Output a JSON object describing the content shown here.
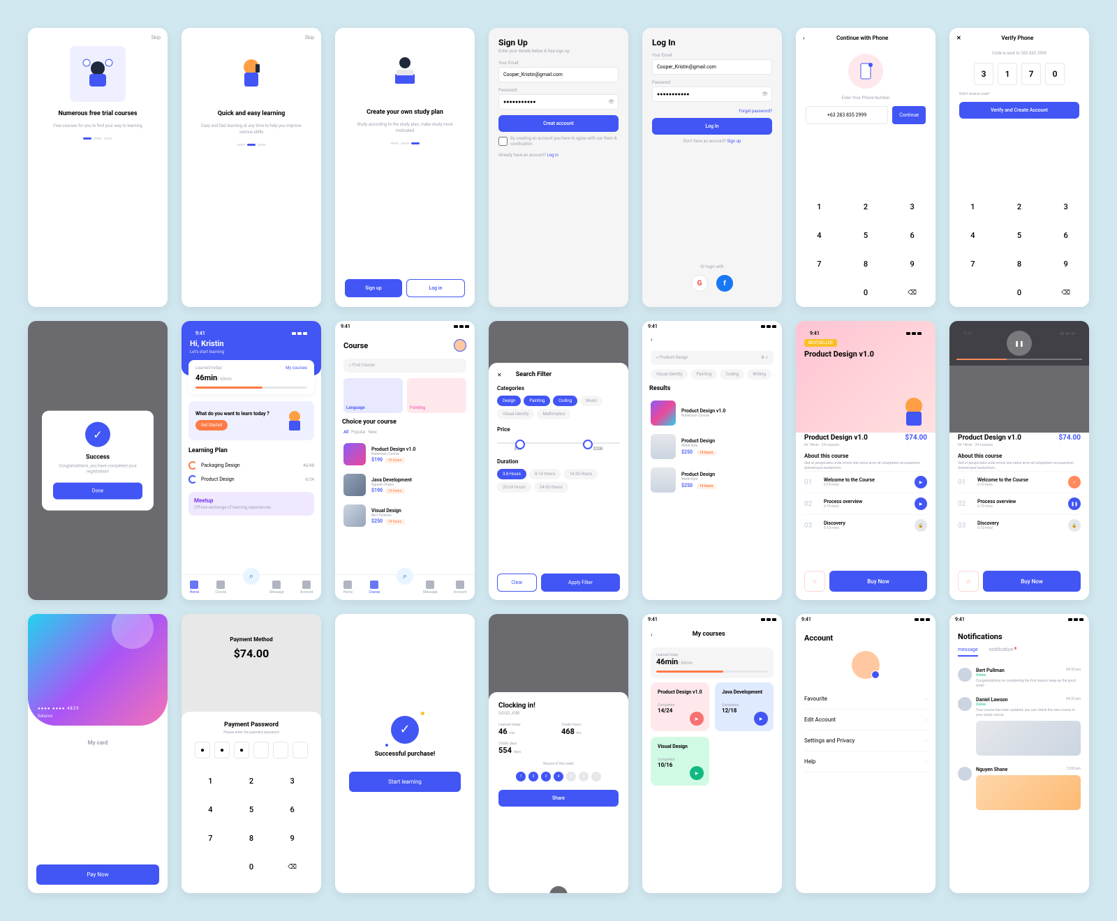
{
  "status_time": "9:41",
  "onb1": {
    "skip": "Skip",
    "title": "Numerous free trial courses",
    "desc": "Free courses for you to find your way to learning"
  },
  "onb2": {
    "skip": "Skip",
    "title": "Quick and easy learning",
    "desc": "Easy and fast learning at any time to help you improve various skills"
  },
  "onb3": {
    "title": "Create your own study plan",
    "desc": "Study according to the study plan, make study more motivated",
    "signup": "Sign up",
    "login": "Log in"
  },
  "signup": {
    "title": "Sign Up",
    "sub": "Enter your details below & free sign up",
    "email_label": "Your Email",
    "email": "Cooper_Kristin@gmail.com",
    "pw_label": "Password",
    "pw": "●●●●●●●●●●●",
    "btn": "Creat account",
    "check": "By creating an account you have to agree with our them & condication.",
    "already": "Already have an account?",
    "login": "Log in"
  },
  "login": {
    "title": "Log In",
    "email_label": "Your Email",
    "email": "Cooper_Kristin@gmail.com",
    "pw_label": "Password",
    "pw": "●●●●●●●●●●●",
    "forgot": "Forget password?",
    "btn": "Log In",
    "noacct": "Don't have an account?",
    "signup": "Sign up",
    "or": "Or login with"
  },
  "phone": {
    "title": "Continue with Phone",
    "enter": "Enter Your Phone Number",
    "value": "+63 283 835 2999",
    "continue": "Continue",
    "keys": [
      "1",
      "2",
      "3",
      "4",
      "5",
      "6",
      "7",
      "8",
      "9",
      "",
      "0",
      "⌫"
    ]
  },
  "verify": {
    "title": "Verify Phone",
    "sent": "Code is sent to 283 835 2999",
    "digits": [
      "3",
      "1",
      "7",
      "0"
    ],
    "didnt": "Didn't receive code?",
    "btn": "Verify and Create Account",
    "keys": [
      "1",
      "2",
      "3",
      "4",
      "5",
      "6",
      "7",
      "8",
      "9",
      "",
      "0",
      "⌫"
    ]
  },
  "success": {
    "title": "Success",
    "desc": "Congratulations, you have completed your registration!",
    "btn": "Done"
  },
  "home": {
    "greeting": "Hi, Kristin",
    "sub": "Let's start learning",
    "learned_label": "Learned today",
    "mycourses": "My courses",
    "learned_val": "46min",
    "learned_goal": "/ 60min",
    "promo_title": "What do you want to learn today ?",
    "promo_btn": "Get Started",
    "plan_title": "Learning Plan",
    "plan1": "Packaging Design",
    "plan1_prog": "40/48",
    "plan2": "Product Design",
    "plan2_prog": "6/24",
    "meetup_title": "Meetup",
    "meetup_desc": "Off-line exchange of learning experiences",
    "tabs": [
      "Home",
      "Course",
      "Search",
      "Message",
      "Account"
    ]
  },
  "course": {
    "title": "Course",
    "search": "Find Course",
    "cat1": "Language",
    "cat2": "Painting",
    "choice": "Choice your course",
    "chips": [
      "All",
      "Popular",
      "New"
    ],
    "c1_name": "Product Design v1.0",
    "c1_author": "Robertson Connie",
    "c1_price": "$190",
    "c1_badge": "16 hours",
    "c2_name": "Java Development",
    "c2_author": "Nguyen Shane",
    "c2_price": "$190",
    "c2_badge": "16 hours",
    "c3_name": "Visual Design",
    "c3_author": "Bert Pullman",
    "c3_price": "$250",
    "c3_badge": "14 hours"
  },
  "filter": {
    "title": "Search Filter",
    "categories": "Categories",
    "cats": [
      "Design",
      "Painting",
      "Coding",
      "Music",
      "Visual identity",
      "Mathmatics"
    ],
    "price": "Price",
    "price_min": "$90",
    "price_max": "$200",
    "duration": "Duration",
    "durs": [
      "3-8 Hours",
      "8-14 Hours",
      "14-20 Hours",
      "20-24 Hours",
      "24-30 Hours"
    ],
    "clear": "Clear",
    "apply": "Apply Filter"
  },
  "results": {
    "search": "Product Design",
    "tags": [
      "Visual identity",
      "Painting",
      "Coding",
      "Writing"
    ],
    "results_label": "Results",
    "r1": "Product Design v1.0",
    "r1_auth": "Robertson Connie",
    "r2": "Product Design",
    "r2_auth": "Webb Kyle",
    "r2_price": "$250",
    "r2_badge": "14 hours",
    "r3": "Product Design",
    "r3_auth": "Webb Kyle",
    "r3_price": "$250",
    "r3_badge": "14 hours"
  },
  "detail": {
    "bestseller": "BESTSELLER",
    "hero_title": "Product Design v1.0",
    "title": "Product Design v1.0",
    "price": "$74.00",
    "meta": "6h 14min · 24 Lessons",
    "about_title": "About this course",
    "about": "Sed ut perspiciatis unde omnis iste natus error sit voluptatem accusantium doloremque laudantium.",
    "less1": "Welcome to the Course",
    "less1_meta": "6:10   mins",
    "less2": "Process overview",
    "less2_meta": "6:10   mins",
    "less3": "Discovery",
    "less3_meta": "6:10   mins",
    "num1": "01",
    "num2": "02",
    "num3": "03",
    "buy": "Buy Now"
  },
  "card": {
    "num": "●●●● ●●●●  4829",
    "balance": "Balance",
    "mycard": "My card",
    "paynow": "Pay Now"
  },
  "payment": {
    "method": "Payment Method",
    "amount": "$74.00",
    "title": "Payment Password",
    "sub": "Please enter the payment password",
    "keys": [
      "1",
      "2",
      "3",
      "4",
      "5",
      "6",
      "7",
      "8",
      "9",
      "",
      "0",
      "⌫"
    ]
  },
  "purchase": {
    "title": "Successful purchase!",
    "btn": "Start learning"
  },
  "clock": {
    "title": "Clocking in!",
    "good": "GOOD JOB!",
    "s1_label": "Learned today",
    "s1_val": "46",
    "s1_unit": "min",
    "s2_label": "Totally hours",
    "s2_val": "468",
    "s2_unit": "hrs",
    "s3_label": "Totally days",
    "s3_val": "554",
    "s3_unit": "days",
    "record": "Record of this week",
    "days": [
      "1",
      "2",
      "3",
      "4",
      "5",
      "6",
      "7"
    ],
    "share": "Share"
  },
  "mycourses": {
    "title": "My courses",
    "today_label": "Learned today",
    "today_val": "46min",
    "today_goal": "/ 60min",
    "c1": "Product Design v1.0",
    "c1_done": "Completed",
    "c1_prog": "14/24",
    "c2": "Java Development",
    "c2_done": "Completed",
    "c2_prog": "12/18",
    "c3": "Visual Design",
    "c3_done": "Completed",
    "c3_prog": "10/16"
  },
  "account": {
    "title": "Account",
    "items": [
      "Favourite",
      "Edit Account",
      "Settings and Privacy",
      "Help"
    ]
  },
  "notif": {
    "title": "Notifications",
    "tab1": "message",
    "tab2": "notification",
    "n1_name": "Bert Pullman",
    "n1_status": "Online",
    "n1_time": "04:32 pm",
    "n1_text": "Congratulations on completing the first lesson, keep up the good work!",
    "n2_name": "Daniel Lawson",
    "n2_status": "Online",
    "n2_time": "04:32 pm",
    "n2_text": "Your course has been updated, you can check the new course in your study course.",
    "n3_name": "Nguyen Shane",
    "n3_time": "12:00 am"
  }
}
